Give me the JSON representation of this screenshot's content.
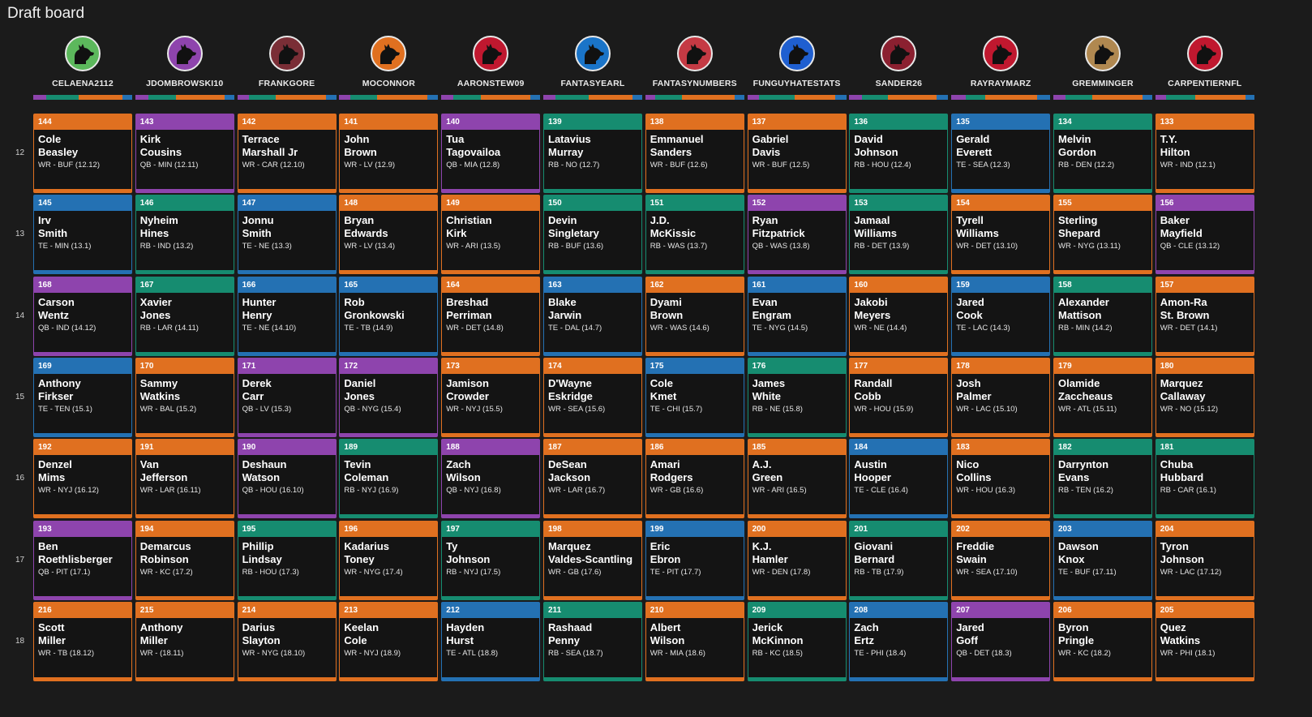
{
  "title": "Draft board",
  "colors": {
    "WR": "#e07020",
    "QB": "#8e44ad",
    "RB": "#168c70",
    "TE": "#2471b3"
  },
  "teams": [
    {
      "name": "CELAENA2112",
      "avatar_color": "#5cb85c",
      "icon": "dog-silhouette-icon"
    },
    {
      "name": "JDOMBROWSKI10",
      "avatar_color": "#8e44ad",
      "icon": "dog-silhouette-icon"
    },
    {
      "name": "FRANKGORE",
      "avatar_color": "#7a2e36",
      "icon": "dog-silhouette-icon"
    },
    {
      "name": "MOCONNOR",
      "avatar_color": "#e07020",
      "icon": "dog-silhouette-icon"
    },
    {
      "name": "AARONSTEW09",
      "avatar_color": "#c0182f",
      "icon": "dog-silhouette-icon"
    },
    {
      "name": "FANTASYEARL",
      "avatar_color": "#1a74c8",
      "icon": "dog-silhouette-icon"
    },
    {
      "name": "FANTASYNUMBERS",
      "avatar_color": "#c53a44",
      "icon": "dog-silhouette-icon"
    },
    {
      "name": "FUNGUYHATESTATS",
      "avatar_color": "#1f5fd0",
      "icon": "dog-silhouette-icon"
    },
    {
      "name": "SANDER26",
      "avatar_color": "#8b2030",
      "icon": "dog-silhouette-icon"
    },
    {
      "name": "RAYRAYMARZ",
      "avatar_color": "#c0182f",
      "icon": "dog-silhouette-icon"
    },
    {
      "name": "GREMMINGER",
      "avatar_color": "#b08850",
      "icon": "dog-silhouette-icon"
    },
    {
      "name": "CARPENTIERNFL",
      "avatar_color": "#c0182f",
      "icon": "dog-silhouette-icon"
    }
  ],
  "position_bars": [
    [
      [
        "QB",
        0.13
      ],
      [
        "RB",
        0.33
      ],
      [
        "WR",
        0.44
      ],
      [
        "TE",
        0.1
      ]
    ],
    [
      [
        "QB",
        0.13
      ],
      [
        "RB",
        0.28
      ],
      [
        "WR",
        0.49
      ],
      [
        "TE",
        0.1
      ]
    ],
    [
      [
        "QB",
        0.12
      ],
      [
        "RB",
        0.27
      ],
      [
        "WR",
        0.51
      ],
      [
        "TE",
        0.1
      ]
    ],
    [
      [
        "QB",
        0.11
      ],
      [
        "RB",
        0.27
      ],
      [
        "WR",
        0.51
      ],
      [
        "TE",
        0.11
      ]
    ],
    [
      [
        "QB",
        0.12
      ],
      [
        "RB",
        0.28
      ],
      [
        "WR",
        0.5
      ],
      [
        "TE",
        0.1
      ]
    ],
    [
      [
        "QB",
        0.12
      ],
      [
        "RB",
        0.34
      ],
      [
        "WR",
        0.44
      ],
      [
        "TE",
        0.1
      ]
    ],
    [
      [
        "QB",
        0.1
      ],
      [
        "RB",
        0.27
      ],
      [
        "WR",
        0.53
      ],
      [
        "TE",
        0.1
      ]
    ],
    [
      [
        "QB",
        0.12
      ],
      [
        "RB",
        0.36
      ],
      [
        "WR",
        0.41
      ],
      [
        "TE",
        0.11
      ]
    ],
    [
      [
        "QB",
        0.13
      ],
      [
        "RB",
        0.26
      ],
      [
        "WR",
        0.49
      ],
      [
        "TE",
        0.12
      ]
    ],
    [
      [
        "QB",
        0.15
      ],
      [
        "RB",
        0.19
      ],
      [
        "WR",
        0.53
      ],
      [
        "TE",
        0.13
      ]
    ],
    [
      [
        "QB",
        0.12
      ],
      [
        "RB",
        0.27
      ],
      [
        "WR",
        0.51
      ],
      [
        "TE",
        0.1
      ]
    ],
    [
      [
        "QB",
        0.11
      ],
      [
        "RB",
        0.29
      ],
      [
        "WR",
        0.51
      ],
      [
        "TE",
        0.09
      ]
    ]
  ],
  "rounds": [
    {
      "label": "12",
      "picks": [
        {
          "no": "144",
          "first": "Cole",
          "last": "Beasley",
          "info": "WR - BUF (12.12)",
          "pos": "WR"
        },
        {
          "no": "143",
          "first": "Kirk",
          "last": "Cousins",
          "info": "QB - MIN (12.11)",
          "pos": "QB"
        },
        {
          "no": "142",
          "first": "Terrace",
          "last": "Marshall Jr",
          "info": "WR - CAR (12.10)",
          "pos": "WR"
        },
        {
          "no": "141",
          "first": "John",
          "last": "Brown",
          "info": "WR - LV (12.9)",
          "pos": "WR"
        },
        {
          "no": "140",
          "first": "Tua",
          "last": "Tagovailoa",
          "info": "QB - MIA (12.8)",
          "pos": "QB"
        },
        {
          "no": "139",
          "first": "Latavius",
          "last": "Murray",
          "info": "RB - NO (12.7)",
          "pos": "RB"
        },
        {
          "no": "138",
          "first": "Emmanuel",
          "last": "Sanders",
          "info": "WR - BUF (12.6)",
          "pos": "WR"
        },
        {
          "no": "137",
          "first": "Gabriel",
          "last": "Davis",
          "info": "WR - BUF (12.5)",
          "pos": "WR"
        },
        {
          "no": "136",
          "first": "David",
          "last": "Johnson",
          "info": "RB - HOU (12.4)",
          "pos": "RB"
        },
        {
          "no": "135",
          "first": "Gerald",
          "last": "Everett",
          "info": "TE - SEA (12.3)",
          "pos": "TE"
        },
        {
          "no": "134",
          "first": "Melvin",
          "last": "Gordon",
          "info": "RB - DEN (12.2)",
          "pos": "RB"
        },
        {
          "no": "133",
          "first": "T.Y.",
          "last": "Hilton",
          "info": "WR - IND (12.1)",
          "pos": "WR"
        }
      ]
    },
    {
      "label": "13",
      "picks": [
        {
          "no": "145",
          "first": "Irv",
          "last": "Smith",
          "info": "TE - MIN (13.1)",
          "pos": "TE"
        },
        {
          "no": "146",
          "first": "Nyheim",
          "last": "Hines",
          "info": "RB - IND (13.2)",
          "pos": "RB"
        },
        {
          "no": "147",
          "first": "Jonnu",
          "last": "Smith",
          "info": "TE - NE (13.3)",
          "pos": "TE"
        },
        {
          "no": "148",
          "first": "Bryan",
          "last": "Edwards",
          "info": "WR - LV (13.4)",
          "pos": "WR"
        },
        {
          "no": "149",
          "first": "Christian",
          "last": "Kirk",
          "info": "WR - ARI (13.5)",
          "pos": "WR"
        },
        {
          "no": "150",
          "first": "Devin",
          "last": "Singletary",
          "info": "RB - BUF (13.6)",
          "pos": "RB"
        },
        {
          "no": "151",
          "first": "J.D.",
          "last": "McKissic",
          "info": "RB - WAS (13.7)",
          "pos": "RB"
        },
        {
          "no": "152",
          "first": "Ryan",
          "last": "Fitzpatrick",
          "info": "QB - WAS (13.8)",
          "pos": "QB"
        },
        {
          "no": "153",
          "first": "Jamaal",
          "last": "Williams",
          "info": "RB - DET (13.9)",
          "pos": "RB"
        },
        {
          "no": "154",
          "first": "Tyrell",
          "last": "Williams",
          "info": "WR - DET (13.10)",
          "pos": "WR"
        },
        {
          "no": "155",
          "first": "Sterling",
          "last": "Shepard",
          "info": "WR - NYG (13.11)",
          "pos": "WR"
        },
        {
          "no": "156",
          "first": "Baker",
          "last": "Mayfield",
          "info": "QB - CLE (13.12)",
          "pos": "QB"
        }
      ]
    },
    {
      "label": "14",
      "picks": [
        {
          "no": "168",
          "first": "Carson",
          "last": "Wentz",
          "info": "QB - IND (14.12)",
          "pos": "QB"
        },
        {
          "no": "167",
          "first": "Xavier",
          "last": "Jones",
          "info": "RB - LAR (14.11)",
          "pos": "RB"
        },
        {
          "no": "166",
          "first": "Hunter",
          "last": "Henry",
          "info": "TE - NE (14.10)",
          "pos": "TE"
        },
        {
          "no": "165",
          "first": "Rob",
          "last": "Gronkowski",
          "info": "TE - TB (14.9)",
          "pos": "TE"
        },
        {
          "no": "164",
          "first": "Breshad",
          "last": "Perriman",
          "info": "WR - DET (14.8)",
          "pos": "WR"
        },
        {
          "no": "163",
          "first": "Blake",
          "last": "Jarwin",
          "info": "TE - DAL (14.7)",
          "pos": "TE"
        },
        {
          "no": "162",
          "first": "Dyami",
          "last": "Brown",
          "info": "WR - WAS (14.6)",
          "pos": "WR"
        },
        {
          "no": "161",
          "first": "Evan",
          "last": "Engram",
          "info": "TE - NYG (14.5)",
          "pos": "TE"
        },
        {
          "no": "160",
          "first": "Jakobi",
          "last": "Meyers",
          "info": "WR - NE (14.4)",
          "pos": "WR"
        },
        {
          "no": "159",
          "first": "Jared",
          "last": "Cook",
          "info": "TE - LAC (14.3)",
          "pos": "TE"
        },
        {
          "no": "158",
          "first": "Alexander",
          "last": "Mattison",
          "info": "RB - MIN (14.2)",
          "pos": "RB"
        },
        {
          "no": "157",
          "first": "Amon-Ra",
          "last": "St. Brown",
          "info": "WR - DET (14.1)",
          "pos": "WR"
        }
      ]
    },
    {
      "label": "15",
      "picks": [
        {
          "no": "169",
          "first": "Anthony",
          "last": "Firkser",
          "info": "TE - TEN (15.1)",
          "pos": "TE"
        },
        {
          "no": "170",
          "first": "Sammy",
          "last": "Watkins",
          "info": "WR - BAL (15.2)",
          "pos": "WR"
        },
        {
          "no": "171",
          "first": "Derek",
          "last": "Carr",
          "info": "QB - LV (15.3)",
          "pos": "QB"
        },
        {
          "no": "172",
          "first": "Daniel",
          "last": "Jones",
          "info": "QB - NYG (15.4)",
          "pos": "QB"
        },
        {
          "no": "173",
          "first": "Jamison",
          "last": "Crowder",
          "info": "WR - NYJ (15.5)",
          "pos": "WR"
        },
        {
          "no": "174",
          "first": "D'Wayne",
          "last": "Eskridge",
          "info": "WR - SEA (15.6)",
          "pos": "WR"
        },
        {
          "no": "175",
          "first": "Cole",
          "last": "Kmet",
          "info": "TE - CHI (15.7)",
          "pos": "TE"
        },
        {
          "no": "176",
          "first": "James",
          "last": "White",
          "info": "RB - NE (15.8)",
          "pos": "RB"
        },
        {
          "no": "177",
          "first": "Randall",
          "last": "Cobb",
          "info": "WR - HOU (15.9)",
          "pos": "WR"
        },
        {
          "no": "178",
          "first": "Josh",
          "last": "Palmer",
          "info": "WR - LAC (15.10)",
          "pos": "WR"
        },
        {
          "no": "179",
          "first": "Olamide",
          "last": "Zaccheaus",
          "info": "WR - ATL (15.11)",
          "pos": "WR"
        },
        {
          "no": "180",
          "first": "Marquez",
          "last": "Callaway",
          "info": "WR - NO (15.12)",
          "pos": "WR"
        }
      ]
    },
    {
      "label": "16",
      "picks": [
        {
          "no": "192",
          "first": "Denzel",
          "last": "Mims",
          "info": "WR - NYJ (16.12)",
          "pos": "WR"
        },
        {
          "no": "191",
          "first": "Van",
          "last": "Jefferson",
          "info": "WR - LAR (16.11)",
          "pos": "WR"
        },
        {
          "no": "190",
          "first": "Deshaun",
          "last": "Watson",
          "info": "QB - HOU (16.10)",
          "pos": "QB"
        },
        {
          "no": "189",
          "first": "Tevin",
          "last": "Coleman",
          "info": "RB - NYJ (16.9)",
          "pos": "RB"
        },
        {
          "no": "188",
          "first": "Zach",
          "last": "Wilson",
          "info": "QB - NYJ (16.8)",
          "pos": "QB"
        },
        {
          "no": "187",
          "first": "DeSean",
          "last": "Jackson",
          "info": "WR - LAR (16.7)",
          "pos": "WR"
        },
        {
          "no": "186",
          "first": "Amari",
          "last": "Rodgers",
          "info": "WR - GB (16.6)",
          "pos": "WR"
        },
        {
          "no": "185",
          "first": "A.J.",
          "last": "Green",
          "info": "WR - ARI (16.5)",
          "pos": "WR"
        },
        {
          "no": "184",
          "first": "Austin",
          "last": "Hooper",
          "info": "TE - CLE (16.4)",
          "pos": "TE"
        },
        {
          "no": "183",
          "first": "Nico",
          "last": "Collins",
          "info": "WR - HOU (16.3)",
          "pos": "WR"
        },
        {
          "no": "182",
          "first": "Darrynton",
          "last": "Evans",
          "info": "RB - TEN (16.2)",
          "pos": "RB"
        },
        {
          "no": "181",
          "first": "Chuba",
          "last": "Hubbard",
          "info": "RB - CAR (16.1)",
          "pos": "RB"
        }
      ]
    },
    {
      "label": "17",
      "picks": [
        {
          "no": "193",
          "first": "Ben",
          "last": "Roethlisberger",
          "info": "QB - PIT (17.1)",
          "pos": "QB"
        },
        {
          "no": "194",
          "first": "Demarcus",
          "last": "Robinson",
          "info": "WR - KC (17.2)",
          "pos": "WR"
        },
        {
          "no": "195",
          "first": "Phillip",
          "last": "Lindsay",
          "info": "RB - HOU (17.3)",
          "pos": "RB"
        },
        {
          "no": "196",
          "first": "Kadarius",
          "last": "Toney",
          "info": "WR - NYG (17.4)",
          "pos": "WR"
        },
        {
          "no": "197",
          "first": "Ty",
          "last": "Johnson",
          "info": "RB - NYJ (17.5)",
          "pos": "RB"
        },
        {
          "no": "198",
          "first": "Marquez",
          "last": "Valdes-Scantling",
          "info": "WR - GB (17.6)",
          "pos": "WR"
        },
        {
          "no": "199",
          "first": "Eric",
          "last": "Ebron",
          "info": "TE - PIT (17.7)",
          "pos": "TE"
        },
        {
          "no": "200",
          "first": "K.J.",
          "last": "Hamler",
          "info": "WR - DEN (17.8)",
          "pos": "WR"
        },
        {
          "no": "201",
          "first": "Giovani",
          "last": "Bernard",
          "info": "RB - TB (17.9)",
          "pos": "RB"
        },
        {
          "no": "202",
          "first": "Freddie",
          "last": "Swain",
          "info": "WR - SEA (17.10)",
          "pos": "WR"
        },
        {
          "no": "203",
          "first": "Dawson",
          "last": "Knox",
          "info": "TE - BUF (17.11)",
          "pos": "TE"
        },
        {
          "no": "204",
          "first": "Tyron",
          "last": "Johnson",
          "info": "WR - LAC (17.12)",
          "pos": "WR"
        }
      ]
    },
    {
      "label": "18",
      "picks": [
        {
          "no": "216",
          "first": "Scott",
          "last": "Miller",
          "info": "WR - TB (18.12)",
          "pos": "WR"
        },
        {
          "no": "215",
          "first": "Anthony",
          "last": "Miller",
          "info": "WR - (18.11)",
          "pos": "WR"
        },
        {
          "no": "214",
          "first": "Darius",
          "last": "Slayton",
          "info": "WR - NYG (18.10)",
          "pos": "WR"
        },
        {
          "no": "213",
          "first": "Keelan",
          "last": "Cole",
          "info": "WR - NYJ (18.9)",
          "pos": "WR"
        },
        {
          "no": "212",
          "first": "Hayden",
          "last": "Hurst",
          "info": "TE - ATL (18.8)",
          "pos": "TE"
        },
        {
          "no": "211",
          "first": "Rashaad",
          "last": "Penny",
          "info": "RB - SEA (18.7)",
          "pos": "RB"
        },
        {
          "no": "210",
          "first": "Albert",
          "last": "Wilson",
          "info": "WR - MIA (18.6)",
          "pos": "WR"
        },
        {
          "no": "209",
          "first": "Jerick",
          "last": "McKinnon",
          "info": "RB - KC (18.5)",
          "pos": "RB"
        },
        {
          "no": "208",
          "first": "Zach",
          "last": "Ertz",
          "info": "TE - PHI (18.4)",
          "pos": "TE"
        },
        {
          "no": "207",
          "first": "Jared",
          "last": "Goff",
          "info": "QB - DET (18.3)",
          "pos": "QB"
        },
        {
          "no": "206",
          "first": "Byron",
          "last": "Pringle",
          "info": "WR - KC (18.2)",
          "pos": "WR"
        },
        {
          "no": "205",
          "first": "Quez",
          "last": "Watkins",
          "info": "WR - PHI (18.1)",
          "pos": "WR"
        }
      ]
    }
  ]
}
